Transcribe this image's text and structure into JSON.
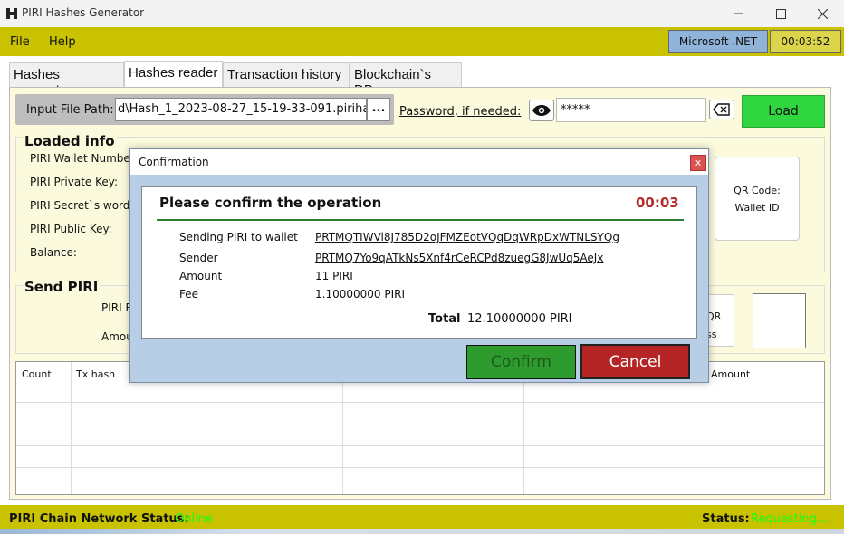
{
  "window": {
    "title": "PIRI Hashes Generator"
  },
  "menu": {
    "file": "File",
    "help": "Help"
  },
  "runtime": {
    "framework": ".NET badge",
    "framework_label": "Microsoft .NET",
    "clock": "00:03:52"
  },
  "tabs": [
    {
      "label": "Hashes generator"
    },
    {
      "label": "Hashes reader"
    },
    {
      "label": "Transaction history"
    },
    {
      "label": "Blockchain`s DBs"
    }
  ],
  "reader": {
    "input_label": "Input File Path:",
    "path_value": "d\\Hash_1_2023-08-27_15-19-33-091.pirihash",
    "browse_label": "...",
    "password_label": "Password, if needed:",
    "password_value": "*****",
    "load_label": "Load"
  },
  "loaded_info": {
    "title": "Loaded info",
    "labels": [
      "PIRI Wallet Number:",
      "PIRI Private Key:",
      "PIRI Secret`s words",
      "PIRI Public Key:",
      "Balance:"
    ],
    "qr_line1": "QR Code:",
    "qr_line2": "Wallet ID"
  },
  "send": {
    "title": "Send PIRI",
    "label1": "PIRI R",
    "label2": "Amou",
    "qr_line1": "QR",
    "qr_line2": "ss"
  },
  "grid": {
    "headers": [
      "Count",
      "Tx hash",
      "Amount"
    ]
  },
  "status": {
    "network_label": "PIRI Chain Network Status:",
    "network_value": "Online",
    "status_label": "Status:",
    "status_value": "Requesting..."
  },
  "dialog": {
    "title": "Confirmation",
    "close": "x",
    "heading": "Please confirm the operation",
    "timer": "00:03",
    "rows": [
      {
        "label": "Sending PIRI to wallet",
        "value": "PRTMQTIWVi8J785D2oJFMZEotVQqDqWRpDxWTNLSYQg"
      },
      {
        "label": "Sender",
        "value": "PRTMQ7Yo9qATkNs5Xnf4rCeRCPd8zuegG8JwUq5AeJx"
      },
      {
        "label": "Amount",
        "value": "11 PIRI"
      },
      {
        "label": "Fee",
        "value": "1.10000000 PIRI"
      }
    ],
    "total_label": "Total",
    "total_value": "12.10000000 PIRI",
    "confirm_label": "Confirm",
    "cancel_label": "Cancel"
  },
  "colors": {
    "menubar": "#c8c200",
    "panel": "#fcfadd",
    "load_button": "#2fd63f",
    "confirm_button": "#2e9b2e",
    "cancel_button": "#b62525",
    "timer": "#b32b2b",
    "online": "#16ff16"
  }
}
